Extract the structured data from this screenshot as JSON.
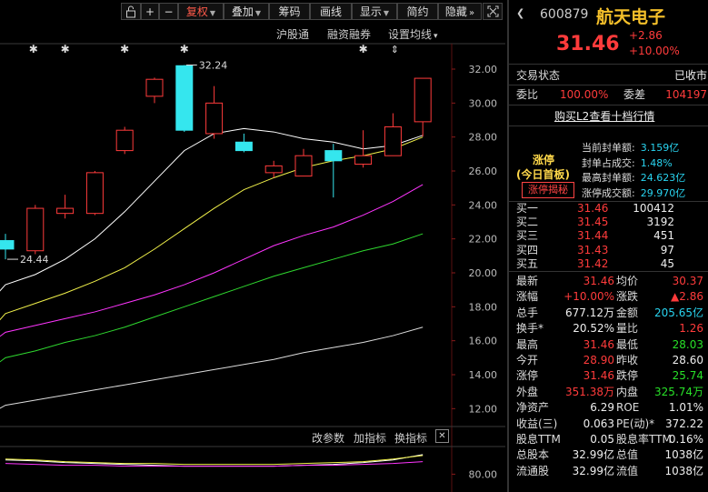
{
  "toolbar": {
    "lock_icon": "lock-icon",
    "zoom_in": "+",
    "zoom_out": "−",
    "buttons": [
      {
        "label": "复权",
        "active": true,
        "caret": true
      },
      {
        "label": "叠加",
        "active": false,
        "caret": true
      },
      {
        "label": "筹码",
        "active": false,
        "caret": false
      },
      {
        "label": "画线",
        "active": false,
        "caret": false
      },
      {
        "label": "显示",
        "active": false,
        "caret": true
      },
      {
        "label": "简约",
        "active": false,
        "caret": false
      },
      {
        "label": "隐藏",
        "active": false,
        "caret": false
      }
    ],
    "expand_icon": "double-chevron-right-icon",
    "fullscreen_icon": "fullscreen-icon"
  },
  "chart_links": {
    "hsgt": "沪股通",
    "margin": "融资融券",
    "ma_settings": "设置均线",
    "ma_caret": "▾"
  },
  "chart_data": {
    "type": "candlestick",
    "ylim": [
      11.0,
      33.5
    ],
    "y_ticks": [
      "32.00",
      "30.00",
      "28.00",
      "26.00",
      "24.00",
      "22.00",
      "20.00",
      "18.00",
      "16.00",
      "14.00",
      "12.00"
    ],
    "annotations": {
      "high": "32.24",
      "low": "24.44"
    },
    "candles": [
      {
        "o": 21.9,
        "c": 21.4,
        "h": 22.3,
        "l": 20.8
      },
      {
        "o": 21.3,
        "c": 23.8,
        "h": 24.0,
        "l": 21.1
      },
      {
        "o": 23.5,
        "c": 23.8,
        "h": 24.6,
        "l": 23.2
      },
      {
        "o": 23.5,
        "c": 25.9,
        "h": 26.0,
        "l": 23.4
      },
      {
        "o": 27.2,
        "c": 28.4,
        "h": 28.6,
        "l": 27.0
      },
      {
        "o": 30.4,
        "c": 31.4,
        "h": 31.5,
        "l": 30.0
      },
      {
        "o": 32.2,
        "c": 28.4,
        "h": 32.24,
        "l": 28.3
      },
      {
        "o": 28.2,
        "c": 30.0,
        "h": 31.0,
        "l": 27.9
      },
      {
        "o": 27.7,
        "c": 27.2,
        "h": 28.2,
        "l": 27.1
      },
      {
        "o": 25.9,
        "c": 26.3,
        "h": 26.6,
        "l": 25.6
      },
      {
        "o": 25.7,
        "c": 26.9,
        "h": 27.3,
        "l": 25.7
      },
      {
        "o": 27.2,
        "c": 26.6,
        "h": 27.6,
        "l": 24.44
      },
      {
        "o": 26.4,
        "c": 26.9,
        "h": 28.4,
        "l": 26.2
      },
      {
        "o": 26.9,
        "c": 28.6,
        "h": 29.4,
        "l": 26.9
      },
      {
        "o": 28.9,
        "c": 31.46,
        "h": 31.46,
        "l": 28.03
      }
    ],
    "ma_series": [
      {
        "color": "#ffffff",
        "values": [
          19.3,
          19.9,
          20.8,
          22.0,
          23.6,
          25.4,
          27.2,
          28.2,
          28.5,
          28.3,
          27.9,
          27.7,
          27.3,
          27.5,
          28.1
        ]
      },
      {
        "color": "#f0f04a",
        "values": [
          17.6,
          18.2,
          18.8,
          19.5,
          20.3,
          21.4,
          22.6,
          23.8,
          24.9,
          25.6,
          26.2,
          26.6,
          26.9,
          27.3,
          28.0
        ]
      },
      {
        "color": "#ff35ff",
        "values": [
          16.5,
          16.9,
          17.3,
          17.7,
          18.2,
          18.7,
          19.3,
          20.0,
          20.8,
          21.6,
          22.2,
          22.7,
          23.4,
          24.2,
          25.2
        ]
      },
      {
        "color": "#2fd82f",
        "values": [
          15.0,
          15.4,
          15.9,
          16.3,
          16.8,
          17.4,
          18.0,
          18.6,
          19.2,
          19.8,
          20.3,
          20.8,
          21.3,
          21.7,
          22.3
        ]
      },
      {
        "color": "#dddddd",
        "values": [
          12.2,
          12.5,
          12.8,
          13.1,
          13.4,
          13.7,
          14.0,
          14.3,
          14.6,
          14.9,
          15.3,
          15.6,
          15.9,
          16.3,
          16.8
        ]
      }
    ],
    "sub_ticks": [
      "80.00"
    ],
    "sub_series": [
      {
        "color": "#ffffff",
        "values": [
          96,
          95,
          93,
          92,
          91,
          90,
          89,
          89,
          89,
          89,
          90,
          91,
          93,
          96,
          102
        ]
      },
      {
        "color": "#f0f04a",
        "values": [
          97,
          96,
          94,
          93,
          92,
          92,
          91,
          91,
          91,
          91,
          92,
          93,
          94,
          97,
          101
        ]
      },
      {
        "color": "#ff35ff",
        "values": [
          92,
          91,
          90,
          90,
          89,
          89,
          89,
          89,
          89,
          89,
          90,
          90,
          91,
          92,
          94
        ]
      }
    ]
  },
  "sub_panel": {
    "params": "改参数",
    "add_indicator": "加指标",
    "switch_indicator": "换指标",
    "close": "✕"
  },
  "stock": {
    "code": "600879",
    "name": "航天电子",
    "price": "31.46",
    "change": "+2.86",
    "change_pct": "+10.00%",
    "trade_status_label": "交易状态",
    "trade_status": "已收市",
    "weibi_label": "委比",
    "weibi": "100.00%",
    "weicha_label": "委差",
    "weicha": "104197",
    "l2_link": "购买L2查看十档行情"
  },
  "limit_up": {
    "title": "涨停",
    "subtitle": "(今日首板)",
    "reveal_button": "涨停揭秘",
    "items": [
      {
        "label": "当前封单额:",
        "value": "3.159亿"
      },
      {
        "label": "封单占成交:",
        "value": "1.48%"
      },
      {
        "label": "最高封单额:",
        "value": "24.623亿"
      },
      {
        "label": "涨停成交额:",
        "value": "29.970亿"
      }
    ]
  },
  "order_book": [
    {
      "label": "买一",
      "price": "31.46",
      "vol": "100412"
    },
    {
      "label": "买二",
      "price": "31.45",
      "vol": "3192"
    },
    {
      "label": "买三",
      "price": "31.44",
      "vol": "451"
    },
    {
      "label": "买四",
      "price": "31.43",
      "vol": "97"
    },
    {
      "label": "买五",
      "price": "31.42",
      "vol": "45"
    }
  ],
  "quotes": [
    {
      "l1": "最新",
      "v1": "31.46",
      "c1": "red",
      "l2": "均价",
      "v2": "30.37",
      "c2": "red"
    },
    {
      "l1": "涨幅",
      "v1": "+10.00%",
      "c1": "red",
      "l2": "涨跌",
      "v2": "▲2.86",
      "c2": "red"
    },
    {
      "l1": "总手",
      "v1": "677.12万",
      "c1": "white",
      "l2": "金额",
      "v2": "205.65亿",
      "c2": "cyan"
    },
    {
      "l1": "换手*",
      "v1": "20.52%",
      "c1": "white",
      "l2": "量比",
      "v2": "1.26",
      "c2": "red"
    },
    {
      "l1": "最高",
      "v1": "31.46",
      "c1": "red",
      "l2": "最低",
      "v2": "28.03",
      "c2": "green"
    },
    {
      "l1": "今开",
      "v1": "28.90",
      "c1": "red",
      "l2": "昨收",
      "v2": "28.60",
      "c2": "white"
    },
    {
      "l1": "涨停",
      "v1": "31.46",
      "c1": "red",
      "l2": "跌停",
      "v2": "25.74",
      "c2": "green"
    },
    {
      "l1": "外盘",
      "v1": "351.38万",
      "c1": "red",
      "l2": "内盘",
      "v2": "325.74万",
      "c2": "green"
    },
    {
      "l1": "净资产",
      "v1": "6.29",
      "c1": "white",
      "l2": "ROE",
      "v2": "1.01%",
      "c2": "white"
    },
    {
      "l1": "收益(三)",
      "v1": "0.063",
      "c1": "white",
      "l2": "PE(动)*",
      "v2": "372.22",
      "c2": "white"
    },
    {
      "l1": "股息TTM",
      "v1": "0.05",
      "c1": "white",
      "l2": "股息率TTM",
      "v2": "0.16%",
      "c2": "white"
    },
    {
      "l1": "总股本",
      "v1": "32.99亿",
      "c1": "white",
      "l2": "总值",
      "v2": "1038亿",
      "c2": "white"
    },
    {
      "l1": "流通股",
      "v1": "32.99亿",
      "c1": "white",
      "l2": "流值",
      "v2": "1038亿",
      "c2": "white"
    }
  ]
}
